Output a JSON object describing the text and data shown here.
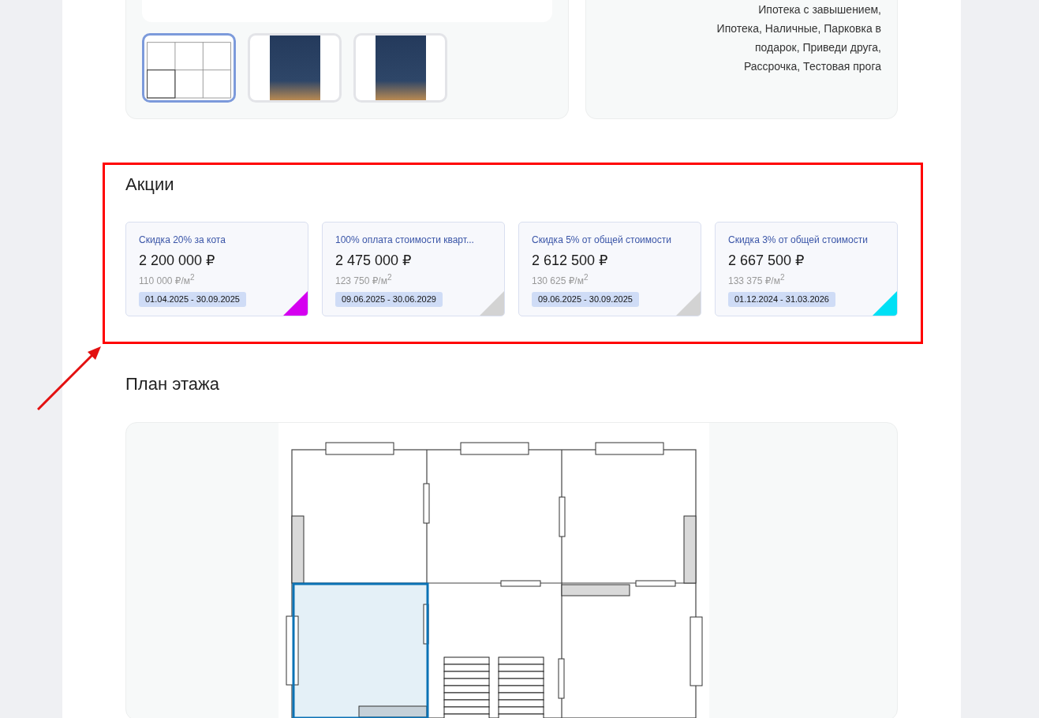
{
  "gallery": {
    "thumbnails": [
      {
        "kind": "plan",
        "selected": true
      },
      {
        "kind": "photo",
        "selected": false
      },
      {
        "kind": "photo",
        "selected": false
      }
    ]
  },
  "payment_methods": {
    "text": "Ипотека с завышением, Ипотека, Наличные, Парковка в подарок, Приведи друга, Рассрочка, Тестовая прога"
  },
  "promotions": {
    "title": "Акции",
    "items": [
      {
        "name": "Скидка 20% за кота",
        "price": "2 200 000 ₽",
        "price_per_m2": "110 000 ₽/м$^{2}$",
        "period": "01.04.2025 - 30.09.2025",
        "color": "#d500f0"
      },
      {
        "name": "100% оплата стоимости кварт...",
        "price": "2 475 000 ₽",
        "price_per_m2": "123 750 ₽/м$^{2}$",
        "period": "09.06.2025 - 30.06.2029",
        "color": "#d3d3d3"
      },
      {
        "name": "Скидка 5% от общей стоимости",
        "price": "2 612 500 ₽",
        "price_per_m2": "130 625 ₽/м$^{2}$",
        "period": "09.06.2025 - 30.09.2025",
        "color": "#d3d3d3"
      },
      {
        "name": "Скидка 3% от общей стоимости",
        "price": "2 667 500 ₽",
        "price_per_m2": "133 375 ₽/м$^{2}$",
        "period": "01.12.2024 - 31.03.2026",
        "color": "#00e0f5"
      }
    ]
  },
  "floor_plan": {
    "title": "План этажа"
  }
}
